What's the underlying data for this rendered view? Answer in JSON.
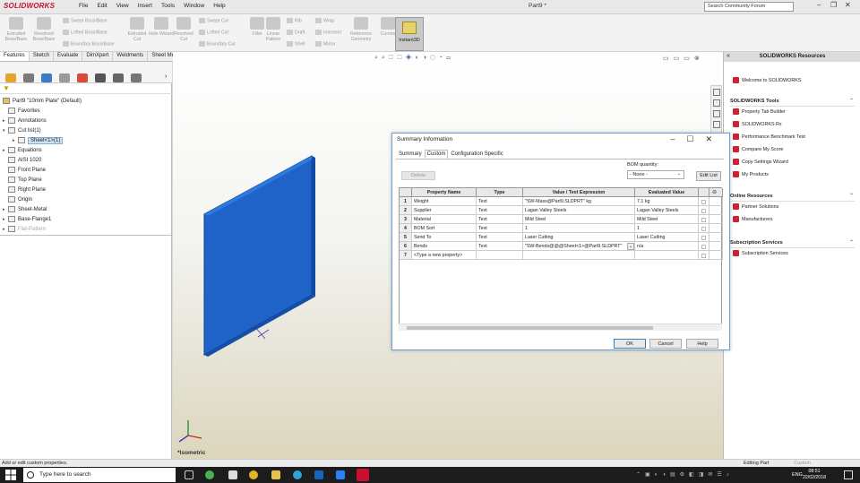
{
  "app": {
    "logo": "SOLIDWORKS",
    "menus": [
      "File",
      "Edit",
      "View",
      "Insert",
      "Tools",
      "Window",
      "Help"
    ],
    "doc_title": "Part9 *",
    "search_placeholder": "Search Community Forum"
  },
  "ribbon": {
    "large": [
      {
        "label": "Extruded Boss/Base",
        "key": "extruded-boss"
      },
      {
        "label": "Revolved Boss/Base",
        "key": "revolved-boss"
      },
      {
        "label": "Extruded Cut",
        "key": "extruded-cut"
      },
      {
        "label": "Hole Wizard",
        "key": "hole-wizard"
      },
      {
        "label": "Revolved Cut",
        "key": "revolved-cut"
      },
      {
        "label": "Fillet",
        "key": "fillet"
      },
      {
        "label": "Linear Pattern",
        "key": "linear-pattern"
      },
      {
        "label": "Reference Geometry",
        "key": "reference-geometry"
      },
      {
        "label": "Curves",
        "key": "curves"
      }
    ],
    "small": [
      "Swept Boss/Base",
      "Lofted Boss/Base",
      "Boundary Boss/Base",
      "Swept Cut",
      "Lofted Cut",
      "Boundary Cut",
      "Rib",
      "Draft",
      "Shell",
      "Wrap",
      "Intersect",
      "Mirror"
    ],
    "instant3d": "Instant3D"
  },
  "cmd_tabs": [
    "Features",
    "Sketch",
    "Evaluate",
    "DimXpert",
    "Weldments",
    "Sheet Metal",
    "Tools",
    "SOLIDWORKS CAM"
  ],
  "tree": {
    "root": "Part9 \"10mm Plate\" (Default)",
    "items": [
      {
        "label": "Favorites",
        "indent": 1,
        "exp": ""
      },
      {
        "label": "Annotations",
        "indent": 1,
        "exp": "▸"
      },
      {
        "label": "Cut list(1)",
        "indent": 1,
        "exp": "▾"
      },
      {
        "label": "Sheet<1>(1)",
        "indent": 2,
        "exp": "▸",
        "selected": true
      },
      {
        "label": "Equations",
        "indent": 1,
        "exp": "▸"
      },
      {
        "label": "AISI 1020",
        "indent": 1,
        "exp": ""
      },
      {
        "label": "Front Plane",
        "indent": 1,
        "exp": ""
      },
      {
        "label": "Top Plane",
        "indent": 1,
        "exp": ""
      },
      {
        "label": "Right Plane",
        "indent": 1,
        "exp": ""
      },
      {
        "label": "Origin",
        "indent": 1,
        "exp": ""
      },
      {
        "label": "Sheet-Metal",
        "indent": 1,
        "exp": "▸"
      },
      {
        "label": "Base-Flange1",
        "indent": 1,
        "exp": "▸"
      },
      {
        "label": "Flat-Pattern",
        "indent": 1,
        "exp": "▸",
        "disabled": true
      }
    ]
  },
  "viewport": {
    "view_label": "*Isometric"
  },
  "taskpane": {
    "title": "SOLIDWORKS Resources",
    "welcome": "Welcome to SOLIDWORKS",
    "sections": [
      {
        "title": "SOLIDWORKS Tools",
        "items": [
          "Property Tab Builder",
          "SOLIDWORKS Rx",
          "Performance Benchmark Test",
          "Compare My Score",
          "Copy Settings Wizard",
          "My Products"
        ]
      },
      {
        "title": "Online Resources",
        "items": [
          "Partner Solutions",
          "Manufacturers"
        ]
      },
      {
        "title": "Subscription Services",
        "items": [
          "Subscription Services"
        ]
      }
    ]
  },
  "dialog": {
    "title": "Summary Information",
    "tabs": [
      "Summary",
      "Custom",
      "Configuration Specific"
    ],
    "active_tab": "Custom",
    "delete_label": "Delete",
    "bom_label": "BOM quantity:",
    "bom_value": "- None -",
    "edit_list_label": "Edit List",
    "columns": [
      "",
      "Property Name",
      "Type",
      "Value / Text Expression",
      "Evaluated Value",
      "",
      ""
    ],
    "rows": [
      {
        "num": "1",
        "name": "Weight",
        "type": "Text",
        "value": "\"SW-Mass@Part9.SLDPRT\" kg",
        "evaluated": "7.1 kg"
      },
      {
        "num": "2",
        "name": "Supplier",
        "type": "Text",
        "value": "Lagan Valley Steels",
        "evaluated": "Lagan Valley Steels"
      },
      {
        "num": "3",
        "name": "Material",
        "type": "Text",
        "value": "Mild Steel",
        "evaluated": "Mild Steel"
      },
      {
        "num": "4",
        "name": "BOM Sort",
        "type": "Text",
        "value": "1",
        "evaluated": "1"
      },
      {
        "num": "5",
        "name": "Send To",
        "type": "Text",
        "value": "Laser Cutting",
        "evaluated": "Laser Cutting"
      },
      {
        "num": "6",
        "name": "Bends",
        "type": "Text",
        "value": "\"SW-Bends@@@Sheet<1>@Part9.SLDPRT\"",
        "evaluated": "n/a"
      },
      {
        "num": "7",
        "name": "<Type a new property>",
        "type": "",
        "value": "",
        "evaluated": ""
      }
    ],
    "ok": "OK",
    "cancel": "Cancel",
    "help": "Help"
  },
  "status": {
    "hint": "Add or edit custom properties.",
    "mode": "Editing Part",
    "custom": "Custom"
  },
  "taskbar": {
    "search": "Type here to search",
    "time": "08:51",
    "date": "22/02/2018",
    "lang": "ENG"
  },
  "colors": {
    "plate": "#1f63c9",
    "accent": "#3c7fb1",
    "logo": "#c8102e"
  }
}
